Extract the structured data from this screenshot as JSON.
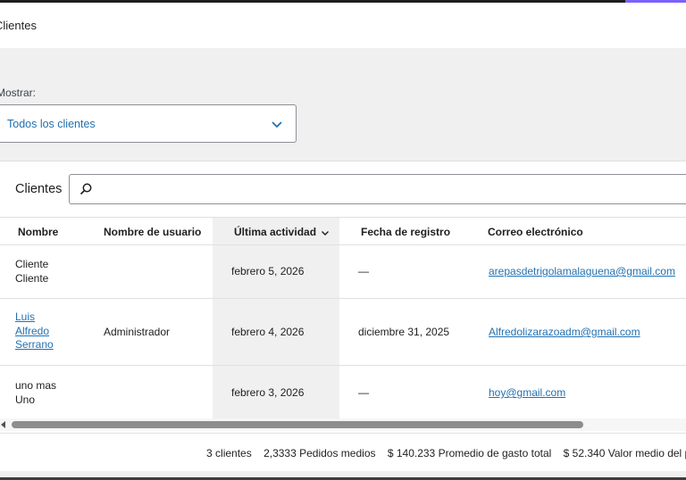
{
  "header": {
    "title": "Clientes"
  },
  "filter": {
    "label": "Mostrar:",
    "selected": "Todos los clientes"
  },
  "search": {
    "label": "Clientes",
    "value": "",
    "placeholder": ""
  },
  "table": {
    "columns": [
      "Nombre",
      "Nombre de usuario",
      "Última actividad",
      "Fecha de registro",
      "Correo electrónico"
    ],
    "rows": [
      {
        "name": [
          "Cliente",
          "Cliente"
        ],
        "username": "",
        "last_active": "febrero 5, 2026",
        "registered": "—",
        "email": "arepasdetrigolamalaguena@gmail.com"
      },
      {
        "name": [
          "Luis",
          "Alfredo",
          "Serrano"
        ],
        "username": "Administrador",
        "last_active": "febrero 4, 2026",
        "registered": "diciembre 31, 2025",
        "email": "Alfredolizarazoadm@gmail.com"
      },
      {
        "name": [
          "uno mas",
          "Uno"
        ],
        "username": "",
        "last_active": "febrero 3, 2026",
        "registered": "—",
        "email": "hoy@gmail.com"
      }
    ]
  },
  "summary": {
    "customers_count": "3",
    "customers_label": "clientes",
    "avg_orders": "2,3333",
    "avg_orders_label": "Pedidos medios",
    "avg_spend": "$ 140.233",
    "avg_spend_label": "Promedio de gasto total",
    "avg_order_value": "$ 52.340",
    "avg_order_value_label": "Valor medio del pedido"
  },
  "colors": {
    "accent": "#2271b1",
    "topbar_accent": "#7b61ff"
  }
}
